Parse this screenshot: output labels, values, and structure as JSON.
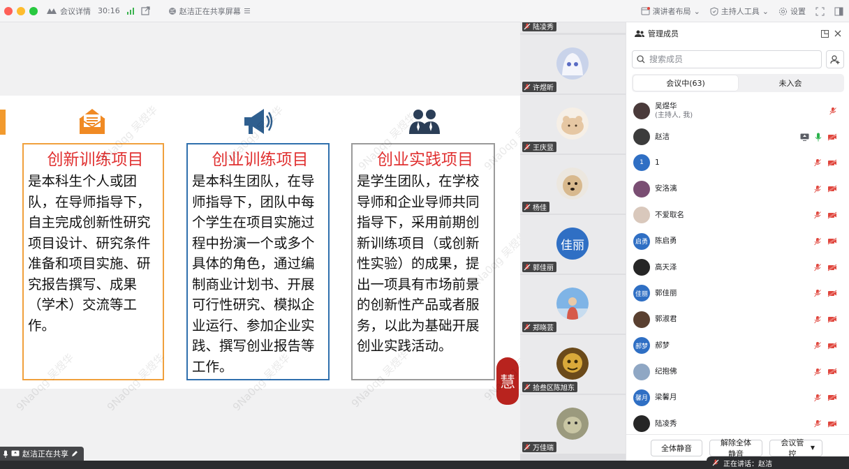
{
  "titlebar": {
    "meeting_details": "会议详情",
    "timer": "30:16",
    "sharing_title": "赵洁正在共享屏幕",
    "presenter_layout": "演讲者布局",
    "host_tools": "主持人工具",
    "settings": "设置"
  },
  "slide": {
    "watermark": "9Na0qg 吴煜华",
    "columns": [
      {
        "title": "创新训练项目",
        "body": "是本科生个人或团队，在导师指导下，自主完成创新性研究项目设计、研究条件准备和项目实施、研究报告撰写、成果（学术）交流等工作。",
        "border": "#f0a03c",
        "icon": "envelope-icon"
      },
      {
        "title": "创业训练项目",
        "body": "是本科生团队，在导师指导下，团队中每个学生在项目实施过程中扮演一个或多个具体的角色，通过编制商业计划书、开展可行性研究、模拟企业运行、参加企业实践、撰写创业报告等工作。",
        "border": "#2f6fad",
        "icon": "megaphone-icon"
      },
      {
        "title": "创业实践项目",
        "body": "是学生团队，在学校导师和企业导师共同指导下，采用前期创新训练项目（或创新性实验）的成果，提出一项具有市场前景的创新性产品或者服务，以此为基础开展创业实践活动。",
        "border": "#9a9a9a",
        "icon": "people-icon"
      }
    ],
    "seal_text": "慧",
    "share_status": "赵洁正在共享"
  },
  "video_tiles": [
    {
      "name": "陆凌秀",
      "avatar": "none"
    },
    {
      "name": "许煜昕",
      "avatar": "anime-girl"
    },
    {
      "name": "王庆昱",
      "avatar": "bear"
    },
    {
      "name": "杨佳",
      "avatar": "dog"
    },
    {
      "name": "郭佳丽",
      "avatar": "text",
      "avatar_text": "佳丽"
    },
    {
      "name": "郑晓芸",
      "avatar": "photo-sky"
    },
    {
      "name": "拾叁区陈旭东",
      "avatar": "gold"
    },
    {
      "name": "万佳瑞",
      "avatar": "meme"
    }
  ],
  "panel": {
    "title": "管理成员",
    "search_placeholder": "搜索成员",
    "tab_in_meeting": "会议中(63)",
    "tab_not_joined": "未入会",
    "members": [
      {
        "name": "吴煜华",
        "sub": "(主持人, 我)",
        "avatar_style": "photo-dark",
        "icons": [
          "mic-off"
        ]
      },
      {
        "name": "赵洁",
        "sub": "",
        "avatar_style": "photo-gray",
        "icons": [
          "screen-share",
          "mic-on",
          "video-off"
        ]
      },
      {
        "name": "1",
        "sub": "",
        "avatar_style": "text-blue",
        "avatar_text": "1",
        "icons": [
          "mic-off",
          "video-off"
        ]
      },
      {
        "name": "安洛漓",
        "sub": "",
        "avatar_style": "photo-purple",
        "icons": [
          "mic-off",
          "video-off"
        ]
      },
      {
        "name": "不爱取名",
        "sub": "",
        "avatar_style": "photo-light",
        "icons": [
          "mic-off",
          "video-off"
        ]
      },
      {
        "name": "陈启勇",
        "sub": "",
        "avatar_style": "text-blue",
        "avatar_text": "启勇",
        "icons": [
          "mic-off",
          "video-off"
        ]
      },
      {
        "name": "高天泽",
        "sub": "",
        "avatar_style": "photo-black",
        "icons": [
          "mic-off",
          "video-off"
        ]
      },
      {
        "name": "郭佳丽",
        "sub": "",
        "avatar_style": "text-blue",
        "avatar_text": "佳丽",
        "icons": [
          "mic-off",
          "video-off"
        ]
      },
      {
        "name": "郭淑君",
        "sub": "",
        "avatar_style": "photo-brown",
        "icons": [
          "mic-off",
          "video-off"
        ]
      },
      {
        "name": "郝梦",
        "sub": "",
        "avatar_style": "text-blue",
        "avatar_text": "郝梦",
        "icons": [
          "mic-off",
          "video-off"
        ]
      },
      {
        "name": "纪抱佛",
        "sub": "",
        "avatar_style": "photo-blue",
        "icons": [
          "mic-off",
          "video-off"
        ]
      },
      {
        "name": "梁馨月",
        "sub": "",
        "avatar_style": "text-blue",
        "avatar_text": "馨月",
        "icons": [
          "mic-off",
          "video-off"
        ]
      },
      {
        "name": "陆凌秀",
        "sub": "",
        "avatar_style": "photo-black",
        "icons": [
          "mic-off",
          "video-off"
        ]
      }
    ],
    "mute_all": "全体静音",
    "unmute_all": "解除全体静音",
    "meeting_control": "会议管控"
  },
  "speaking": "正在讲话：赵洁",
  "colors": {
    "accent": "#2f6fad",
    "mute_red": "#e0453c",
    "mic_green": "#2bb24c",
    "title_red": "#e03030"
  }
}
